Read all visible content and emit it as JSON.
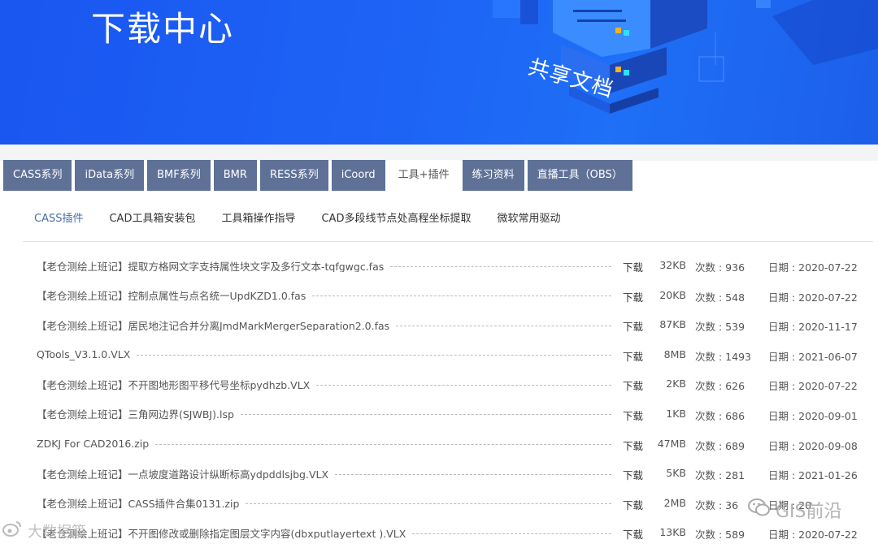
{
  "banner": {
    "title": "下载中心",
    "caption": "共享文档"
  },
  "tabs": [
    {
      "label": "CASS系列",
      "active": false
    },
    {
      "label": "iData系列",
      "active": false
    },
    {
      "label": "BMF系列",
      "active": false
    },
    {
      "label": "BMR",
      "active": false
    },
    {
      "label": "RESS系列",
      "active": false
    },
    {
      "label": "iCoord",
      "active": false
    },
    {
      "label": "工具+插件",
      "active": true
    },
    {
      "label": "练习资料",
      "active": false
    },
    {
      "label": "直播工具（OBS）",
      "active": false
    }
  ],
  "subnav": [
    {
      "label": "CASS插件",
      "active": true
    },
    {
      "label": "CAD工具箱安装包",
      "active": false
    },
    {
      "label": "工具箱操作指导",
      "active": false
    },
    {
      "label": "CAD多段线节点处高程坐标提取",
      "active": false
    },
    {
      "label": "微软常用驱动",
      "active": false
    }
  ],
  "list": {
    "download_label": "下载",
    "count_prefix": "次数 : ",
    "date_prefix": "日期 : ",
    "items": [
      {
        "name": "【老仓测绘上班记】提取方格网文字支持属性块文字及多行文本-tqfgwgc.fas",
        "size": "32KB",
        "count": "936",
        "date": "2020-07-22"
      },
      {
        "name": "【老仓测绘上班记】控制点属性与点名统一UpdKZD1.0.fas",
        "size": "20KB",
        "count": "548",
        "date": "2020-07-22"
      },
      {
        "name": "【老仓测绘上班记】居民地注记合并分离JmdMarkMergerSeparation2.0.fas",
        "size": "87KB",
        "count": "539",
        "date": "2020-11-17"
      },
      {
        "name": "QTools_V3.1.0.VLX",
        "size": "8MB",
        "count": "1493",
        "date": "2021-06-07"
      },
      {
        "name": "【老仓测绘上班记】不开图地形图平移代号坐标pydhzb.VLX",
        "size": "2KB",
        "count": "626",
        "date": "2020-07-22"
      },
      {
        "name": "【老仓测绘上班记】三角网边界(SJWBJ).lsp",
        "size": "1KB",
        "count": "686",
        "date": "2020-09-01"
      },
      {
        "name": "ZDKJ For CAD2016.zip",
        "size": "47MB",
        "count": "689",
        "date": "2020-09-08"
      },
      {
        "name": "【老仓测绘上班记】一点坡度道路设计纵断标高ydpddlsjbg.VLX",
        "size": "5KB",
        "count": "281",
        "date": "2021-01-26"
      },
      {
        "name": "【老仓测绘上班记】CASS插件合集0131.zip",
        "size": "2MB",
        "count": "36",
        "date": "20"
      },
      {
        "name": "【老仓测绘上班记】不开图修改或删除指定图层文字内容(dbxputlayertext ).VLX",
        "size": "13KB",
        "count": "589",
        "date": "2020-07-22"
      }
    ]
  },
  "watermarks": {
    "left": "大数据篇",
    "right": "GIS前沿"
  },
  "colors": {
    "banner": "#1d63f5",
    "tab": "#5f7196",
    "subnav_active": "#4a6fa5"
  }
}
